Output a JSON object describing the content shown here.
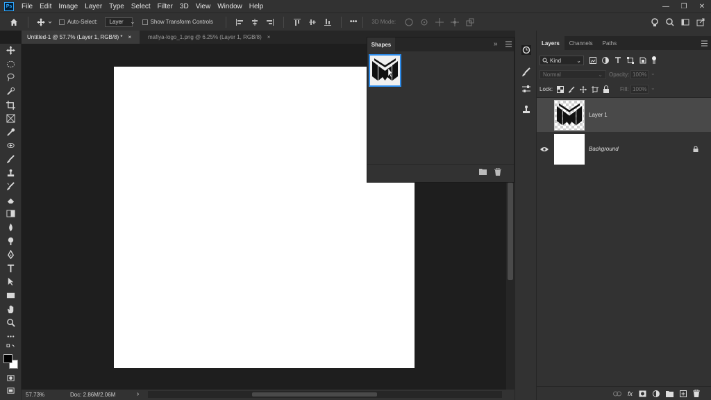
{
  "app": {
    "logo": "Ps"
  },
  "menu": [
    "File",
    "Edit",
    "Image",
    "Layer",
    "Type",
    "Select",
    "Filter",
    "3D",
    "View",
    "Window",
    "Help"
  ],
  "window_controls": [
    "—",
    "❐",
    "✕"
  ],
  "options_bar": {
    "auto_select_label": "Auto-Select:",
    "auto_select_value": "Layer",
    "show_transform_label": "Show Transform Controls",
    "more": "•••",
    "mode_3d_label": "3D Mode:"
  },
  "tabs": [
    {
      "label": "Untitled-1 @ 57.7% (Layer 1, RGB/8) *",
      "close": "×"
    },
    {
      "label": "mafiya-logo_1.png @ 6.25% (Layer 1, RGB/8)",
      "close": "×"
    }
  ],
  "shapes_panel": {
    "title": "Shapes",
    "collapse": "»"
  },
  "layers_panel": {
    "tabs": [
      "Layers",
      "Channels",
      "Paths"
    ],
    "filter_kind": "Kind",
    "blend_mode": "Normal",
    "opacity_label": "Opacity:",
    "opacity_value": "100%",
    "lock_label": "Lock:",
    "fill_label": "Fill:",
    "fill_value": "100%",
    "layers": [
      {
        "name": "Layer 1"
      },
      {
        "name": "Background"
      }
    ]
  },
  "status_bar": {
    "zoom": "57.73%",
    "doc": "Doc: 2.86M/2.06M",
    "arrow": "›"
  },
  "colors": {
    "accent": "#2d8ceb",
    "panel": "#323232",
    "dark": "#262626",
    "canvas_bg": "#1e1e1e"
  }
}
